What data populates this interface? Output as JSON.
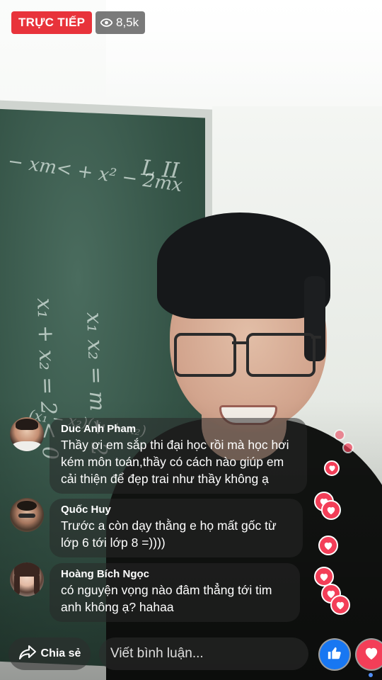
{
  "live": {
    "label": "TRỰC TIẾP",
    "color": "#e8333b"
  },
  "viewers": {
    "icon": "eye-icon",
    "count": "8,5k"
  },
  "comments": [
    {
      "name": "Duc Anh Pham",
      "text": "Thầy ơi em sắp thi đại học rồi mà học hơi kém môn toán,thầy có cách nào giúp em cải thiện để đẹp trai như thầy không ạ"
    },
    {
      "name": "Quốc Huy",
      "text": "Trước a còn dạy thằng e họ mất gốc từ lớp 6 tới lớp 8 =))))"
    },
    {
      "name": "Hoàng Bích Ngọc",
      "text": "có nguyện vọng nào đâm thẳng tới tim anh không ạ? hahaa"
    }
  ],
  "bottom_bar": {
    "share_label": "Chia sẻ",
    "share_icon": "share-arrow-icon",
    "comment_placeholder": "Viết bình luận...",
    "like_icon": "thumbs-up-icon",
    "love_icon": "heart-icon",
    "like_color": "#1877f2",
    "love_color": "#f33e58"
  }
}
